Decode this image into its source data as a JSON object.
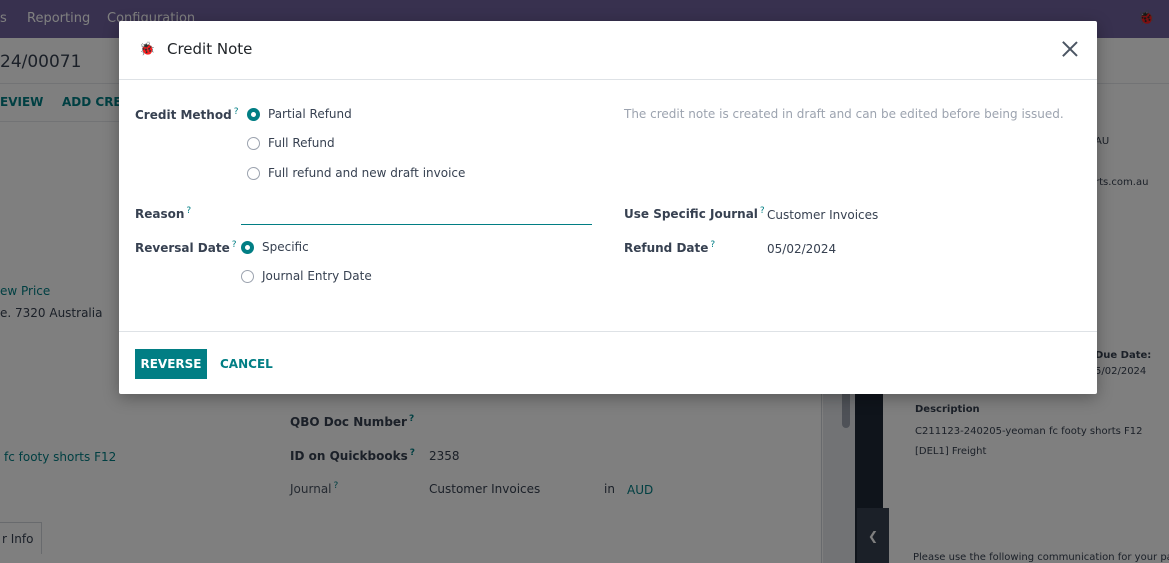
{
  "background": {
    "menu": [
      "s",
      "Reporting",
      "Configuration"
    ],
    "record_title": "24/00071",
    "actions": [
      "EVIEW",
      "ADD CRE"
    ],
    "left_texts": {
      "new_price": "ew Price",
      "address": "e. 7320 Australia",
      "product": "fc footy shorts F12",
      "tab": "r Info"
    },
    "fields": {
      "qbo_doc_label": "QBO Doc Number",
      "qbo_id_label": "ID on Quickbooks",
      "qbo_id_value": "2358",
      "journal_label": "Journal",
      "journal_value": "Customer Invoices",
      "in_label": "in",
      "currency": "AUD"
    },
    "preview": {
      "au": "AU",
      "email_tail": "rts.com.au",
      "due_date_label": "Due Date:",
      "due_date_value": "5/02/2024",
      "description_label": "Description",
      "line1": "C211123-240205-yeoman fc footy shorts F12",
      "line2": "[DEL1] Freight",
      "footer": "Please use the following communication for your payment"
    }
  },
  "modal": {
    "title": "Credit Note",
    "credit_method": {
      "label": "Credit Method",
      "options": [
        "Partial Refund",
        "Full Refund",
        "Full refund and new draft invoice"
      ],
      "selected": "Partial Refund"
    },
    "hint": "The credit note is created in draft and can be edited before being issued.",
    "reason": {
      "label": "Reason",
      "value": ""
    },
    "journal": {
      "label": "Use Specific Journal",
      "value": "Customer Invoices"
    },
    "reversal_date": {
      "label": "Reversal Date",
      "options": [
        "Specific",
        "Journal Entry Date"
      ],
      "selected": "Specific"
    },
    "refund_date": {
      "label": "Refund Date",
      "value": "05/02/2024"
    },
    "buttons": {
      "reverse": "REVERSE",
      "cancel": "CANCEL"
    },
    "colors": {
      "accent": "#017e84",
      "topbar": "#71639e"
    }
  }
}
